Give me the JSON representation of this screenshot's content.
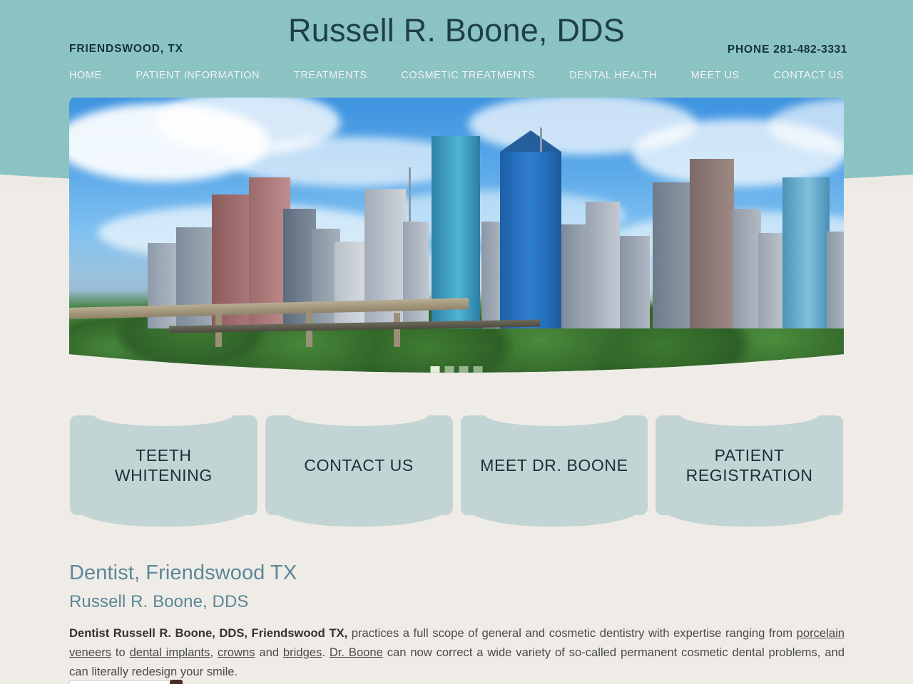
{
  "header": {
    "title": "Russell R. Boone, DDS",
    "location": "FRIENDSWOOD, TX",
    "phone_word": "PHONE",
    "phone_number": "281-482-3331",
    "bg_color": "#8cc4c4",
    "title_color": "#1e3f45"
  },
  "nav": {
    "items": [
      {
        "label": "HOME"
      },
      {
        "label": "PATIENT INFORMATION"
      },
      {
        "label": "TREATMENTS"
      },
      {
        "label": "COSMETIC TREATMENTS"
      },
      {
        "label": "DENTAL HEALTH"
      },
      {
        "label": "MEET US"
      },
      {
        "label": "CONTACT US"
      }
    ]
  },
  "banner": {
    "alt": "Houston downtown skyline with trees and freeway",
    "slides": [
      {
        "active": true
      },
      {
        "active": false
      },
      {
        "active": false
      },
      {
        "active": false
      }
    ]
  },
  "quick_links": {
    "accent_color": "#c3d4d4",
    "text_color": "#163238",
    "buttons": [
      {
        "line1": "TEETH",
        "line2": "WHITENING"
      },
      {
        "line1": "CONTACT US",
        "line2": ""
      },
      {
        "line1": "MEET DR. BOONE",
        "line2": ""
      },
      {
        "line1": "PATIENT",
        "line2": "REGISTRATION"
      }
    ]
  },
  "content": {
    "heading": "Dentist, Friendswood TX",
    "subheading": "Russell R. Boone, DDS",
    "heading_color": "#5b8797",
    "paragraph": {
      "lead": "Dentist Russell R. Boone, DDS, Friendswood TX,",
      "t1": " practices a full scope of general and cosmetic dentistry with expertise ranging from ",
      "link1": "porcelain veneers",
      "t2": " to ",
      "link2": "dental implants",
      "t3": ", ",
      "link3": "crowns",
      "t4": " and ",
      "link4": "bridges",
      "t5": ". ",
      "link5": "Dr. Boone",
      "t6": " can now correct a wide variety of so-called permanent cosmetic dental problems, and can literally redesign your smile."
    }
  }
}
